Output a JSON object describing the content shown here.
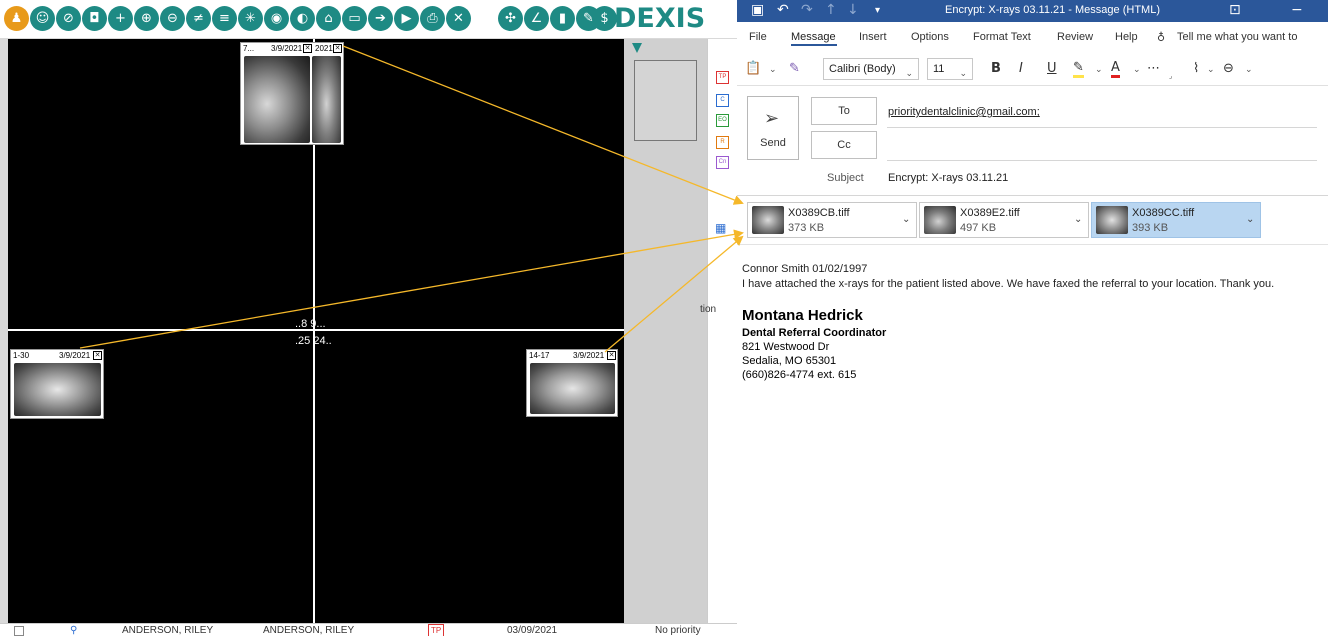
{
  "dexis": {
    "logo": "DEXIS",
    "toolbar_icons": [
      "tooth-icon",
      "patient-icon",
      "edit-icon",
      "camera-icon",
      "add-icon",
      "zoom-in-icon",
      "zoom-out-icon",
      "adjust-icon",
      "notes-icon",
      "brightness-icon",
      "eye-icon",
      "compare-icon",
      "home-icon",
      "folder-icon",
      "export-icon",
      "forward-icon",
      "print-icon",
      "close-icon"
    ],
    "tools_icons": [
      "tool-1-icon",
      "tool-2-icon",
      "tool-3-icon",
      "tool-4-icon",
      "dollar-icon"
    ],
    "quadrant_labels": {
      "upper": "..8 9...",
      "lower": ".25 24.."
    },
    "thumbnails": {
      "top_left": {
        "label": "7...",
        "date": "3/9/2021"
      },
      "top_right": {
        "date": "2021"
      },
      "left": {
        "label": "1-30",
        "date": "3/9/2021"
      },
      "right": {
        "label": "14-17",
        "date": "3/9/2021"
      }
    },
    "side_tags": [
      "TP",
      "C",
      "EO",
      "R",
      "Cn"
    ],
    "strip_text": "tion",
    "back_row": {
      "name1": "ANDERSON, RILEY",
      "name2": "ANDERSON, RILEY",
      "tag": "TP",
      "date": "03/09/2021",
      "priority": "No priority"
    }
  },
  "outlook": {
    "title": "Encrypt: X-rays 03.11.21  -  Message (HTML)",
    "tabs": [
      "File",
      "Message",
      "Insert",
      "Options",
      "Format Text",
      "Review",
      "Help"
    ],
    "tell_me": "Tell me what you want to",
    "font_name": "Calibri (Body)",
    "font_size": "11",
    "send_label": "Send",
    "to_label": "To",
    "cc_label": "Cc",
    "to_value": "prioritydentalclinic@gmail.com;",
    "subject_label": "Subject",
    "subject_value": "Encrypt: X-rays 03.11.21",
    "attachments": [
      {
        "name": "X0389CB.tiff",
        "size": "373 KB",
        "selected": false
      },
      {
        "name": "X0389E2.tiff",
        "size": "497 KB",
        "selected": false
      },
      {
        "name": "X0389CC.tiff",
        "size": "393 KB",
        "selected": true
      }
    ],
    "body_line1": "Connor Smith 01/02/1997",
    "body_line2": "I have attached the x-rays for the patient listed above. We have faxed the referral to your location. Thank you.",
    "signature": {
      "name": "Montana Hedrick",
      "title": "Dental Referral Coordinator",
      "address1": "821 Westwood Dr",
      "address2": "Sedalia, MO 65301",
      "phone": "(660)826-4774 ext. 615"
    }
  },
  "colors": {
    "dexis_teal": "#1e8a84",
    "outlook_blue": "#2b579a",
    "arrow": "#f5b82a",
    "selected_attachment": "#b9d6f1"
  }
}
